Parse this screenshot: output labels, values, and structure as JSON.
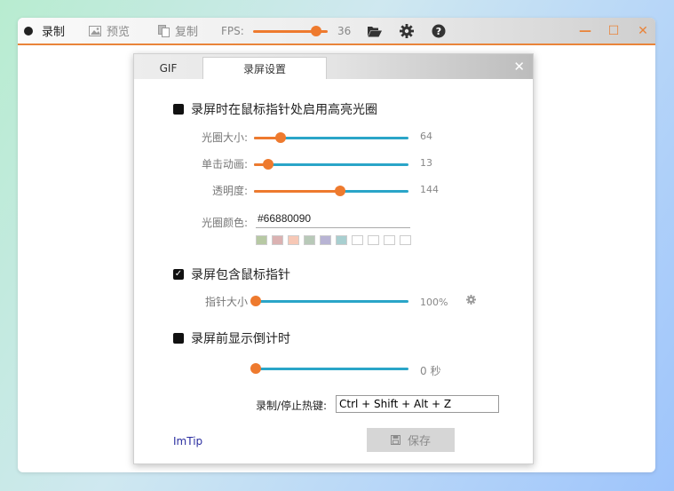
{
  "toolbar": {
    "record_label": "录制",
    "preview_label": "预览",
    "copy_label": "复制",
    "fps_label": "FPS:",
    "fps_value": "36",
    "fps_level": 0.85
  },
  "window_buttons": {
    "minimize": "—",
    "maximize": "☐",
    "close": "✕"
  },
  "dialog": {
    "tabs": [
      {
        "label": "GIF"
      },
      {
        "label": "录屏设置"
      }
    ],
    "active_tab": 1,
    "close_glyph": "✕",
    "highlight": {
      "title": "录屏时在鼠标指针处启用高亮光圈",
      "checked": false,
      "size_label": "光圈大小:",
      "size_value": "64",
      "size_level": 0.17,
      "anim_label": "单击动画:",
      "anim_value": "13",
      "anim_level": 0.09,
      "opacity_label": "透明度:",
      "opacity_value": "144",
      "opacity_level": 0.56,
      "color_label": "光圈颜色:",
      "color_value": "#66880090",
      "swatches": [
        "#b7c9a4",
        "#dbb2b2",
        "#f7c8b6",
        "#b8c9b8",
        "#b8b4d4",
        "#a8cfd0",
        "#ffffff",
        "#ffffff",
        "#ffffff",
        "#ffffff"
      ]
    },
    "cursor": {
      "title": "录屏包含鼠标指针",
      "checked": true,
      "size_label": "指针大小",
      "size_value": "100%",
      "size_level": 0.0
    },
    "countdown": {
      "title": "录屏前显示倒计时",
      "checked": false,
      "value": "0 秒",
      "level": 0.0
    },
    "hotkey": {
      "label": "录制/停止热键:",
      "value": "Ctrl + Shift + Alt + Z"
    },
    "footer_link": "ImTip",
    "save_label": "保存"
  },
  "colors": {
    "accent": "#ee7a2e",
    "track": "#2aa5c8"
  }
}
